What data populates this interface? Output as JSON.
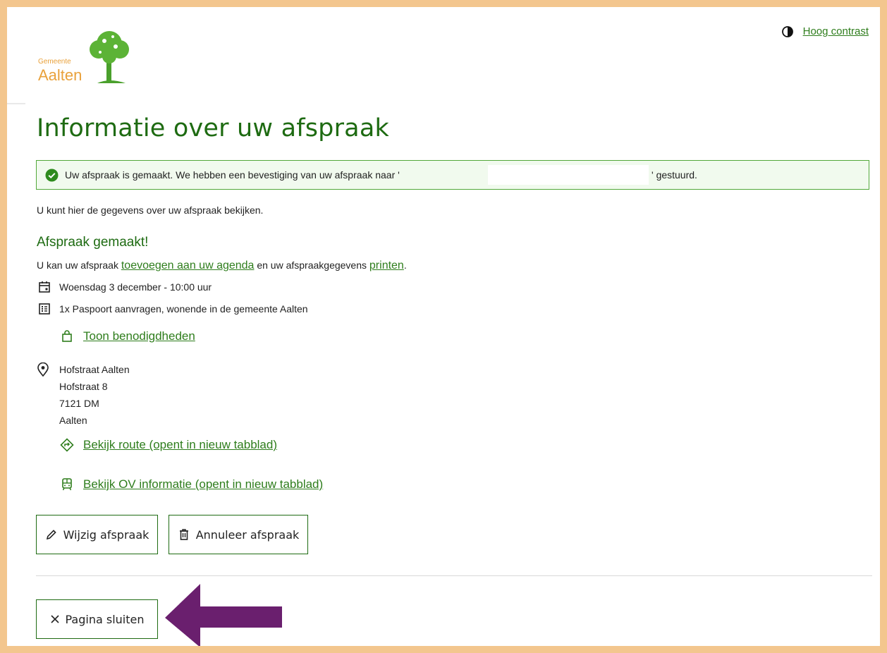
{
  "header": {
    "logo_small": "Gemeente",
    "logo_big": "Aalten",
    "contrast_label": "Hoog contrast"
  },
  "page_title": "Informatie over uw afspraak",
  "alert": {
    "message": "Uw afspraak is gemaakt. We hebben een bevestiging van uw afspraak naar '",
    "message_end": "' gestuurd."
  },
  "intro": "U kunt hier de gegevens over uw afspraak bekijken.",
  "section_title": "Afspraak gemaakt!",
  "addcal": {
    "prefix": "U kan uw afspraak ",
    "agenda_link": "toevoegen aan uw agenda",
    "middle": " en uw afspraakgegevens ",
    "print_link": "printen",
    "suffix": "."
  },
  "appointment": {
    "datetime": "Woensdag 3 december - 10:00 uur",
    "product": "1x Paspoort aanvragen, wonende in de gemeente Aalten",
    "requirements_link": "Toon benodigdheden"
  },
  "location": {
    "name": "Hofstraat Aalten",
    "street": "Hofstraat 8",
    "postcode": "7121 DM",
    "city": "Aalten",
    "route_link": "Bekijk route (opent in nieuw tabblad)",
    "ov_link": "Bekijk OV informatie (opent in nieuw tabblad)"
  },
  "buttons": {
    "edit": "Wijzig afspraak",
    "cancel": "Annuleer afspraak",
    "close": "Pagina sluiten"
  },
  "colors": {
    "brand_green": "#1e6b12",
    "link_green": "#2e7d1c",
    "orange": "#e9a13b",
    "annotation_arrow": "#6a1f6e",
    "page_border": "#f3c68e"
  }
}
